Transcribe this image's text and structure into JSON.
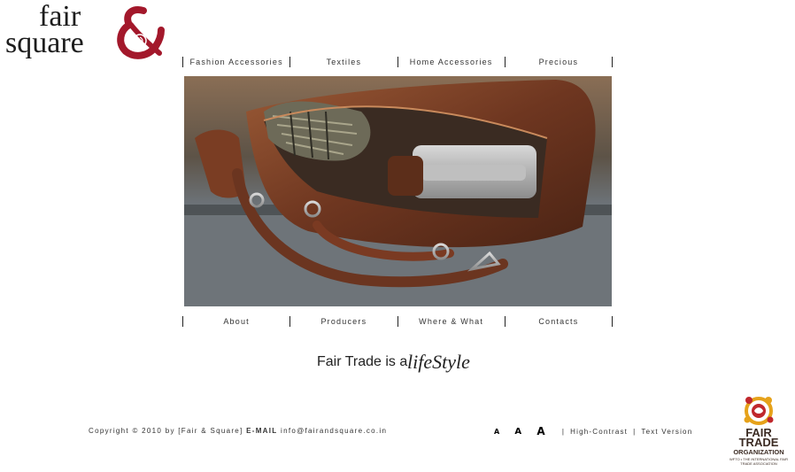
{
  "logo": {
    "line1": "fair",
    "line2": "square"
  },
  "nav_top": [
    {
      "label": "Fashion Accessories"
    },
    {
      "label": "Textiles"
    },
    {
      "label": "Home Accessories"
    },
    {
      "label": "Precious"
    }
  ],
  "nav_bottom": [
    {
      "label": "About"
    },
    {
      "label": "Producers"
    },
    {
      "label": "Where & What"
    },
    {
      "label": "Contacts"
    }
  ],
  "tagline": {
    "plain": "Fair Trade is a",
    "script": "lifeStyle"
  },
  "footer": {
    "copyright": "Copyright © 2010 by [Fair & Square]",
    "email_label": "E-MAIL",
    "email": "info@fairandsquare.co.in",
    "font_size_glyph": "A",
    "separator": "|",
    "high_contrast": "High-Contrast",
    "text_version": "Text Version"
  },
  "wfto": {
    "line1": "FAIR",
    "line2": "TRADE",
    "line3": "ORGANIZATION",
    "line4": "WFTO • THE INTERNATIONAL FAIR TRADE ASSOCIATION"
  },
  "colors": {
    "accent_red": "#a3182b",
    "text": "#222222",
    "leather": "#6b3520"
  },
  "icons": [
    "ampersand-logo-icon",
    "wfto-emblem-icon"
  ]
}
